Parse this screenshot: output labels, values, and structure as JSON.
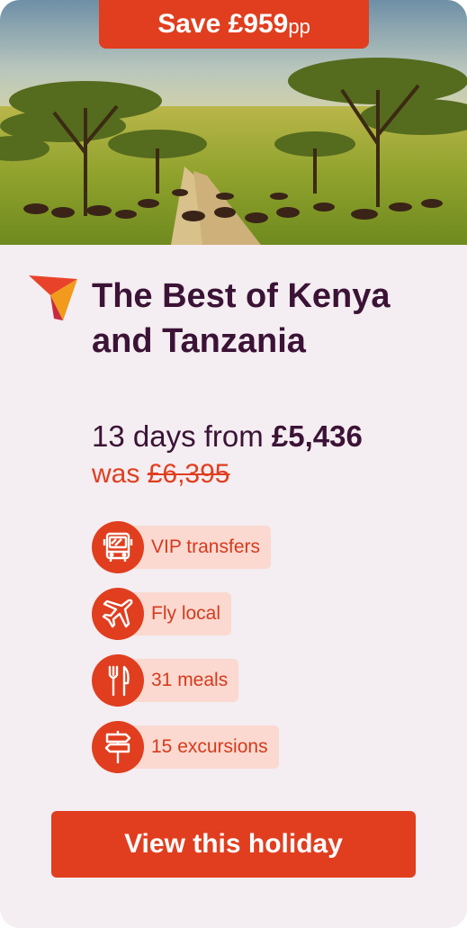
{
  "banner": {
    "save_text": "Save £959",
    "pp": "pp"
  },
  "hero": {
    "image": "safari-wildebeest-migration"
  },
  "logo": {
    "icon": "brand-arrow-logo"
  },
  "holiday": {
    "title": "The Best of Kenya and Tanzania",
    "duration_from": "13 days from",
    "price": "£5,436",
    "was_label": "was",
    "was_price": "£6,395"
  },
  "features": [
    {
      "icon": "bus-icon",
      "label": "VIP transfers"
    },
    {
      "icon": "plane-icon",
      "label": "Fly local"
    },
    {
      "icon": "cutlery-icon",
      "label": "31 meals"
    },
    {
      "icon": "signpost-icon",
      "label": "15 excursions"
    }
  ],
  "cta": {
    "label": "View this holiday"
  },
  "colors": {
    "accent": "#e03e1f",
    "title": "#3b1336",
    "card_bg": "#f4edf1",
    "pill_bg": "#fbd9d0"
  }
}
